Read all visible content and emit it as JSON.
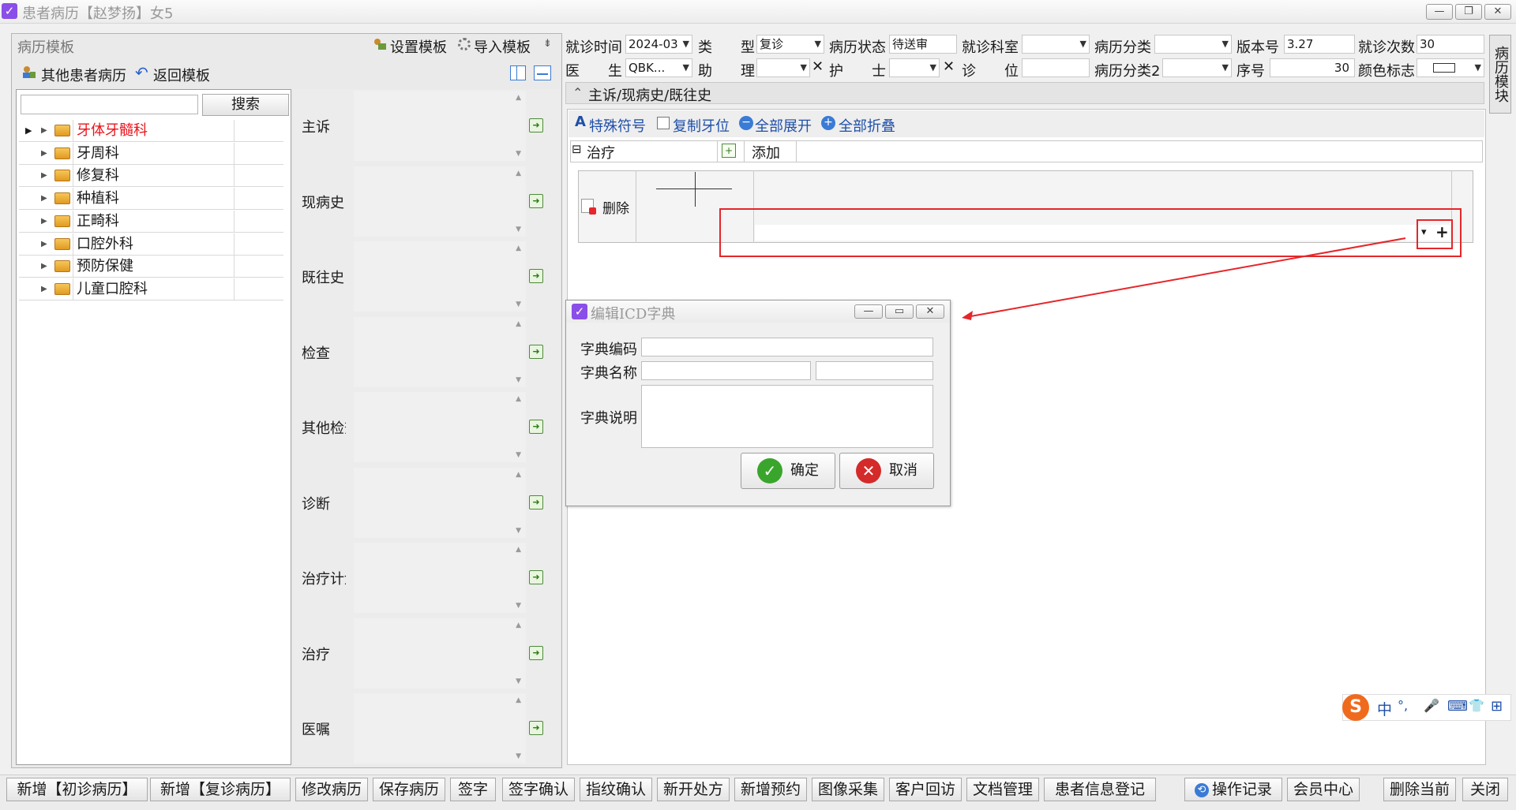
{
  "window": {
    "title": "患者病历【赵梦扬】女5",
    "min": "—",
    "max": "❐",
    "close": "✕"
  },
  "left": {
    "title": "病历模板",
    "set_template": "设置模板",
    "import_template": "导入模板",
    "pin": "⇟",
    "other_records": "其他患者病历",
    "back_template": "返回模板",
    "search_placeholder": "",
    "search_button": "搜索",
    "tree": [
      {
        "label": "牙体牙髓科",
        "selected": true
      },
      {
        "label": "牙周科"
      },
      {
        "label": "修复科"
      },
      {
        "label": "种植科"
      },
      {
        "label": "正畸科"
      },
      {
        "label": "口腔外科"
      },
      {
        "label": "预防保健"
      },
      {
        "label": "儿童口腔科"
      }
    ]
  },
  "fields": [
    {
      "label": "主诉"
    },
    {
      "label": "现病史"
    },
    {
      "label": "既往史"
    },
    {
      "label": "检查"
    },
    {
      "label": "其他检查"
    },
    {
      "label": "诊断"
    },
    {
      "label": "治疗计划"
    },
    {
      "label": "治疗"
    },
    {
      "label": "医嘱"
    }
  ],
  "header": {
    "visit_time_label": "就诊时间",
    "visit_time_value": "2024-03",
    "type_label": "类　　型",
    "type_value": "复诊",
    "status_label": "病历状态",
    "status_value": "待送审",
    "dept_label": "就诊科室",
    "dept_value": "",
    "category_label": "病历分类",
    "category_value": "",
    "version_label": "版本号",
    "version_value": "3.27",
    "visits_label": "就诊次数",
    "visits_value": "30",
    "doctor_label": "医　　生",
    "doctor_value": "QBK...",
    "assistant_label": "助　　理",
    "assistant_value": "",
    "nurse_label": "护　　士",
    "nurse_value": "",
    "chair_label": "诊　　位",
    "chair_value": "",
    "category2_label": "病历分类2",
    "category2_value": "",
    "seq_label": "序号",
    "seq_value": "30",
    "color_label": "颜色标志"
  },
  "section": {
    "title": "主诉/现病史/既往史",
    "collapse_icon": "⌃"
  },
  "toolbar": {
    "special_symbols": "特殊符号",
    "copy_tooth": "复制牙位",
    "expand_all": "全部展开",
    "collapse_all": "全部折叠"
  },
  "treatment": {
    "header": "治疗",
    "add": "添加",
    "delete": "删除",
    "dropdown": "▾",
    "plus": "+"
  },
  "side_tab": "病历模块",
  "dialog": {
    "title": "编辑ICD字典",
    "code_label": "字典编码",
    "name_label": "字典名称",
    "desc_label": "字典说明",
    "code_value": "",
    "name_value": "",
    "name2_value": "",
    "desc_value": "",
    "ok": "确定",
    "cancel": "取消"
  },
  "ime": {
    "logo": "S",
    "lang": "中",
    "punct": "°,",
    "mic": "🎤",
    "kbd": "⌨",
    "shirt": "👕",
    "grid": "⊞"
  },
  "bottom_bar": [
    "新增【初诊病历】",
    "新增【复诊病历】",
    "修改病历",
    "保存病历",
    "签字",
    "签字确认",
    "指纹确认",
    "新开处方",
    "新增预约",
    "图像采集",
    "客户回访",
    "文档管理",
    "患者信息登记",
    "操作记录",
    "会员中心",
    "删除当前",
    "关闭"
  ],
  "colors": {
    "accent_red": "#e5262a",
    "selected_red": "#e8141c",
    "link_blue": "#1f4fa8",
    "purple": "#8a4fe8"
  }
}
